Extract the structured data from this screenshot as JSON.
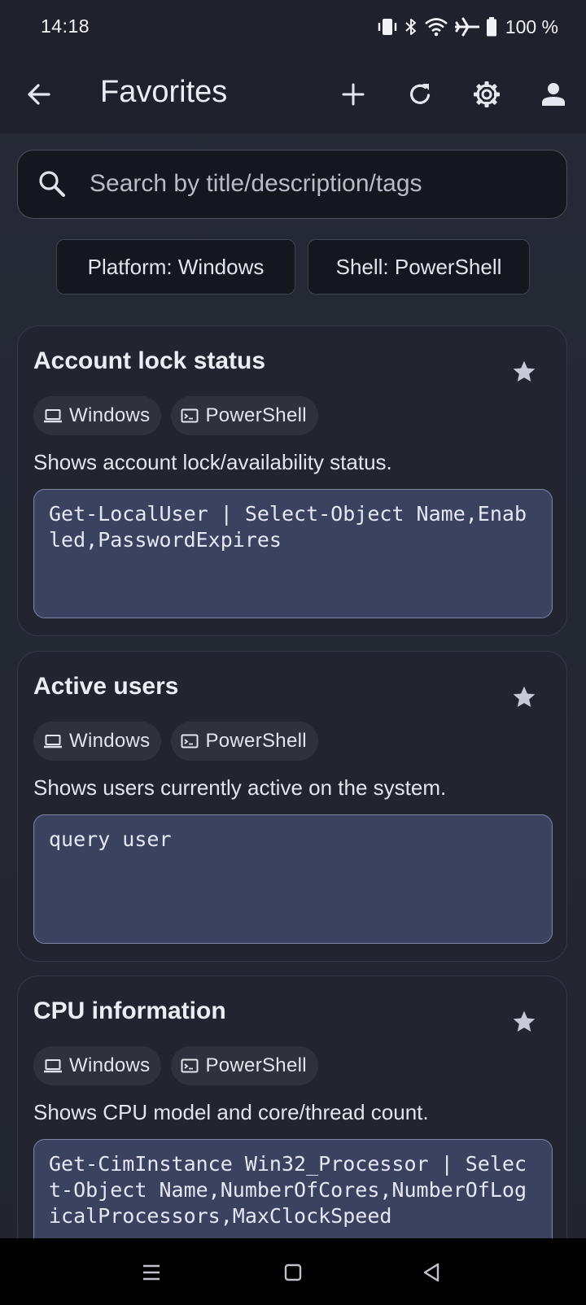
{
  "status_bar": {
    "time": "14:18",
    "icons": [
      "vibrate-icon",
      "bluetooth-icon",
      "wifi-icon",
      "airplane-icon",
      "battery-icon"
    ],
    "battery": "100 %"
  },
  "app_bar": {
    "title": "Favorites",
    "actions": [
      "add-icon",
      "refresh-icon",
      "settings-icon",
      "account-icon"
    ]
  },
  "search": {
    "placeholder": "Search by title/description/tags"
  },
  "filters": [
    {
      "label": "Platform: Windows"
    },
    {
      "label": "Shell: PowerShell"
    }
  ],
  "cards": [
    {
      "title": "Account lock status",
      "tags": [
        {
          "icon": "laptop-icon",
          "label": "Windows"
        },
        {
          "icon": "terminal-icon",
          "label": "PowerShell"
        }
      ],
      "description": "Shows account lock/availability status.",
      "command": "Get-LocalUser | Select-Object Name,Enabled,PasswordExpires",
      "favorite": true
    },
    {
      "title": "Active users",
      "tags": [
        {
          "icon": "laptop-icon",
          "label": "Windows"
        },
        {
          "icon": "terminal-icon",
          "label": "PowerShell"
        }
      ],
      "description": "Shows users currently active on the system.",
      "command": "query user",
      "favorite": true
    },
    {
      "title": "CPU information",
      "tags": [
        {
          "icon": "laptop-icon",
          "label": "Windows"
        },
        {
          "icon": "terminal-icon",
          "label": "PowerShell"
        }
      ],
      "description": "Shows CPU model and core/thread count.",
      "command": "Get-CimInstance Win32_Processor | Select-Object Name,NumberOfCores,NumberOfLogicalProcessors,MaxClockSpeed",
      "favorite": true
    }
  ],
  "colors": {
    "background": "#252833",
    "app_bar": "#1f222c",
    "code_background": "#3a4260",
    "code_border": "#7d86a8",
    "star": "#c7cad6"
  }
}
